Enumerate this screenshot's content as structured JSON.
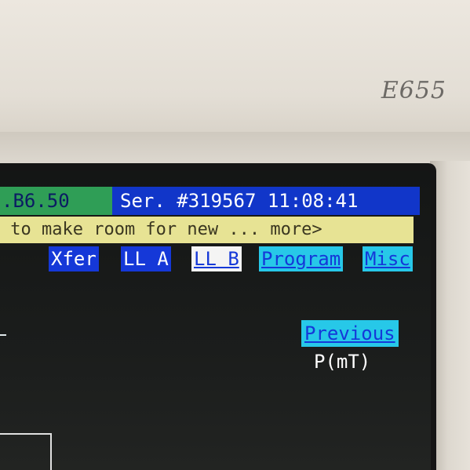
{
  "device": {
    "model": "E655"
  },
  "status_bar": {
    "version": ".B6.50",
    "serial": "Ser. #319567 11:08:41"
  },
  "message_bar": {
    "text": " to make room for new ... more>"
  },
  "menu": {
    "items": [
      {
        "label": "Xfer",
        "style": "blue"
      },
      {
        "label": "LL A",
        "style": "blue"
      },
      {
        "label": "LL B",
        "style": "white-selected"
      },
      {
        "label": "Program",
        "style": "cyan"
      },
      {
        "label": "Misc",
        "style": "cyan"
      }
    ]
  },
  "softkey": {
    "previous_label": "Previous"
  },
  "readout": {
    "unit_label": "P(mT)"
  },
  "colors": {
    "status_green": "#2f9e56",
    "status_blue": "#1136c9",
    "message_yellow": "#e7e394",
    "menu_blue": "#1538d8",
    "menu_cyan": "#27c8e8",
    "screen_bg": "#1b1d1c",
    "bezel": "#e7e2d9"
  }
}
